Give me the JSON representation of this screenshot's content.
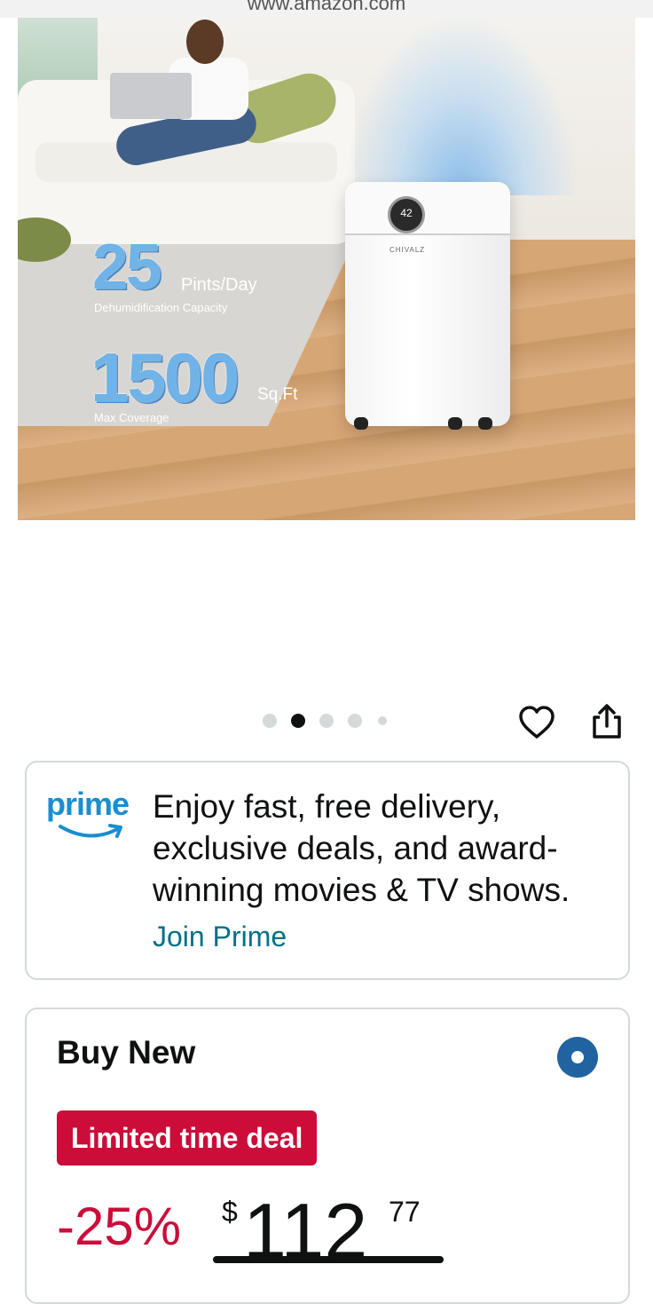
{
  "browser": {
    "url": "www.amazon.com"
  },
  "hero": {
    "dial_value": "42",
    "brand": "CHIVALZ",
    "stat1_value": "25",
    "stat1_unit": "Pints/Day",
    "stat1_caption": "Dehumidification Capacity",
    "stat2_value": "1500",
    "stat2_unit": "Sq.Ft",
    "stat2_caption": "Max Coverage"
  },
  "carousel": {
    "total_dots": 5,
    "active_index": 1
  },
  "actions": {
    "favorite_icon": "heart-icon",
    "share_icon": "share-icon"
  },
  "prime": {
    "logo_text": "prime",
    "message": "Enjoy fast, free delivery, exclusive deals, and award-winning movies & TV shows.",
    "join_label": "Join Prime",
    "brand_color": "#1b8dd0",
    "link_color": "#007185"
  },
  "buy_new": {
    "title": "Buy New",
    "deal_badge": "Limited time deal",
    "discount": "-25%",
    "currency": "$",
    "price_whole": "112",
    "price_fraction": "77",
    "deal_color": "#cc0c39",
    "radio_color": "#2162a1"
  }
}
